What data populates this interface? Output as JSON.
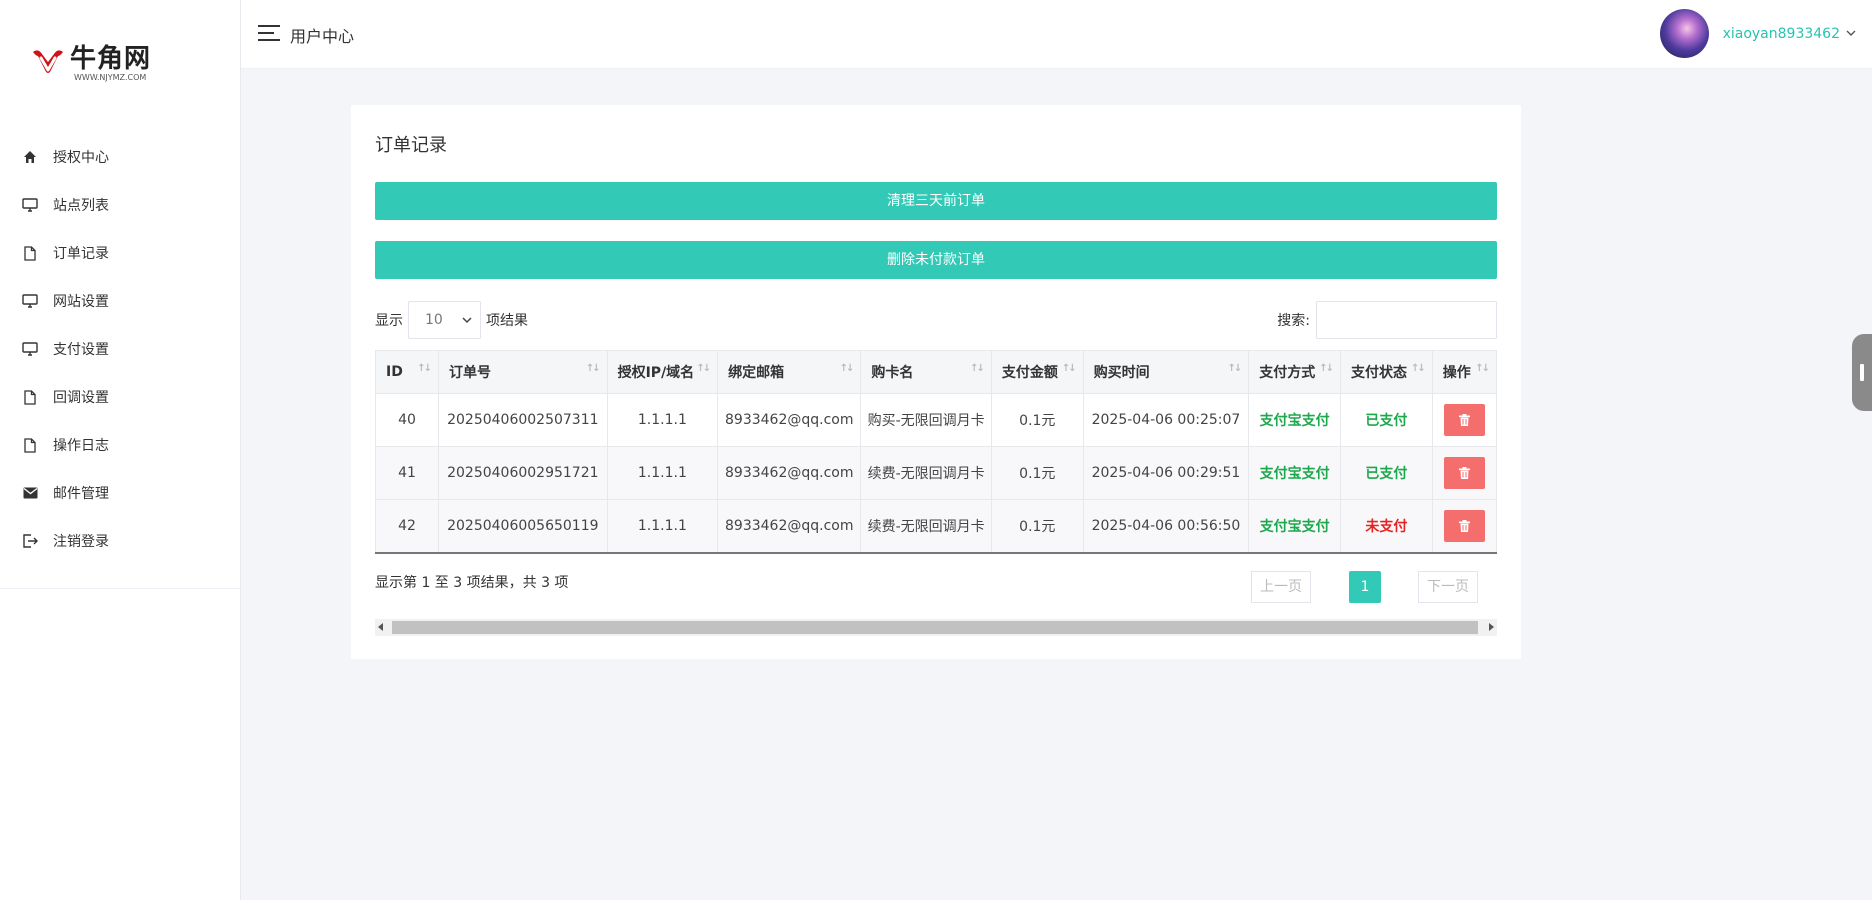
{
  "brand": {
    "name": "牛角网",
    "url": "WWW.NJYMZ.COM"
  },
  "topbar": {
    "title": "用户中心",
    "username": "xiaoyan8933462"
  },
  "sidebar": {
    "items": [
      {
        "label": "授权中心",
        "icon": "home-icon"
      },
      {
        "label": "站点列表",
        "icon": "monitor-icon"
      },
      {
        "label": "订单记录",
        "icon": "file-icon"
      },
      {
        "label": "网站设置",
        "icon": "monitor-icon"
      },
      {
        "label": "支付设置",
        "icon": "monitor-icon"
      },
      {
        "label": "回调设置",
        "icon": "file-icon"
      },
      {
        "label": "操作日志",
        "icon": "file-icon"
      },
      {
        "label": "邮件管理",
        "icon": "mail-icon"
      },
      {
        "label": "注销登录",
        "icon": "logout-icon"
      }
    ]
  },
  "card": {
    "title": "订单记录",
    "clear_button": "清理三天前订单",
    "delete_unpaid_button": "删除未付款订单",
    "length": {
      "prefix": "显示",
      "value": "10",
      "suffix": "项结果"
    },
    "search_label": "搜索:",
    "columns": [
      "ID",
      "订单号",
      "授权IP/域名",
      "绑定邮箱",
      "购卡名",
      "支付金额",
      "购买时间",
      "支付方式",
      "支付状态",
      "操作"
    ],
    "rows": [
      {
        "id": "40",
        "order": "20250406002507311",
        "ip": "1.1.1.1",
        "email": "8933462@qq.com",
        "card": "购买-无限回调月卡",
        "amount": "0.1元",
        "time": "2025-04-06 00:25:07",
        "method": "支付宝支付",
        "status": "已支付"
      },
      {
        "id": "41",
        "order": "20250406002951721",
        "ip": "1.1.1.1",
        "email": "8933462@qq.com",
        "card": "续费-无限回调月卡",
        "amount": "0.1元",
        "time": "2025-04-06 00:29:51",
        "method": "支付宝支付",
        "status": "已支付"
      },
      {
        "id": "42",
        "order": "20250406005650119",
        "ip": "1.1.1.1",
        "email": "8933462@qq.com",
        "card": "续费-无限回调月卡",
        "amount": "0.1元",
        "time": "2025-04-06 00:56:50",
        "method": "支付宝支付",
        "status": "未支付"
      }
    ],
    "info": "显示第 1 至 3 项结果，共 3 项",
    "pager": {
      "prev": "上一页",
      "current": "1",
      "next": "下一页"
    }
  },
  "colors": {
    "accent": "#32c9b7",
    "danger": "#f46e6e",
    "success": "#1ea84d",
    "error": "#e62323"
  }
}
